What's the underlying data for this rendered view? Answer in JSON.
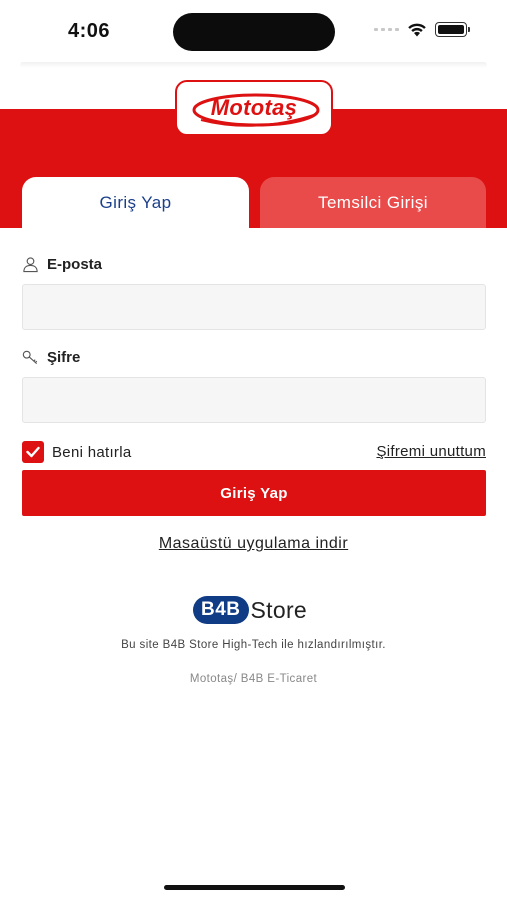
{
  "status_bar": {
    "time": "4:06",
    "icons": [
      "signal-icon",
      "wifi-icon",
      "battery-icon"
    ]
  },
  "brand": {
    "logo_text": "Mototaş",
    "primary_color": "#dd1111",
    "tab_active_text_color": "#1b3f8b"
  },
  "tabs": [
    {
      "label": "Giriş Yap",
      "active": true
    },
    {
      "label": "Temsilci Girişi",
      "active": false
    }
  ],
  "form": {
    "email": {
      "label": "E-posta",
      "value": "",
      "placeholder": "",
      "icon": "user-icon"
    },
    "password": {
      "label": "Şifre",
      "value": "",
      "placeholder": "",
      "icon": "key-icon"
    },
    "remember_me": {
      "label": "Beni hatırla",
      "checked": true
    },
    "forgot_password": "Şifremi unuttum",
    "submit_label": "Giriş Yap"
  },
  "desktop_app_link": "Masaüstü uygulama indir",
  "footer": {
    "logo_b4b": "B4B",
    "logo_store": "Store",
    "powered_by": "Bu site B4B Store High-Tech ile hızlandırılmıştır.",
    "copyright": "Mototaş/ B4B E-Ticaret"
  }
}
